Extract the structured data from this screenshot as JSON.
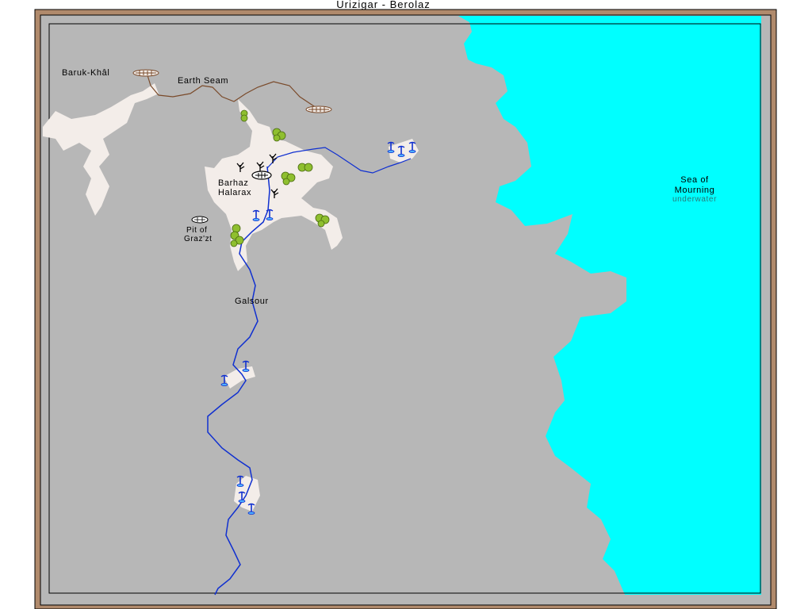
{
  "title": "Urizigar - Berolaz",
  "labels": {
    "baruk_khal": "Baruk-Khâl",
    "earth_seam": "Earth Seam",
    "barhaz_line1": "Barhaz",
    "barhaz_line2": "Halarax",
    "pit_line1": "Pit of",
    "pit_line2": "Graz'zt",
    "galsour": "Galsour",
    "sea_line1": "Sea of",
    "sea_line2": "Mourning",
    "sea_note": "underwater"
  },
  "colors": {
    "frame": "#b08a6c",
    "land": "#b7b7b7",
    "sea": "#00ffff",
    "cleared": "#f3ede9",
    "river": "#1030d0",
    "road": "#7a4a2a",
    "tree": "#8fbf2f"
  },
  "icons": [
    "fountain-icon",
    "tree-icon",
    "dead-tree-icon",
    "tunnel-icon",
    "settlement-icon",
    "pit-icon"
  ]
}
